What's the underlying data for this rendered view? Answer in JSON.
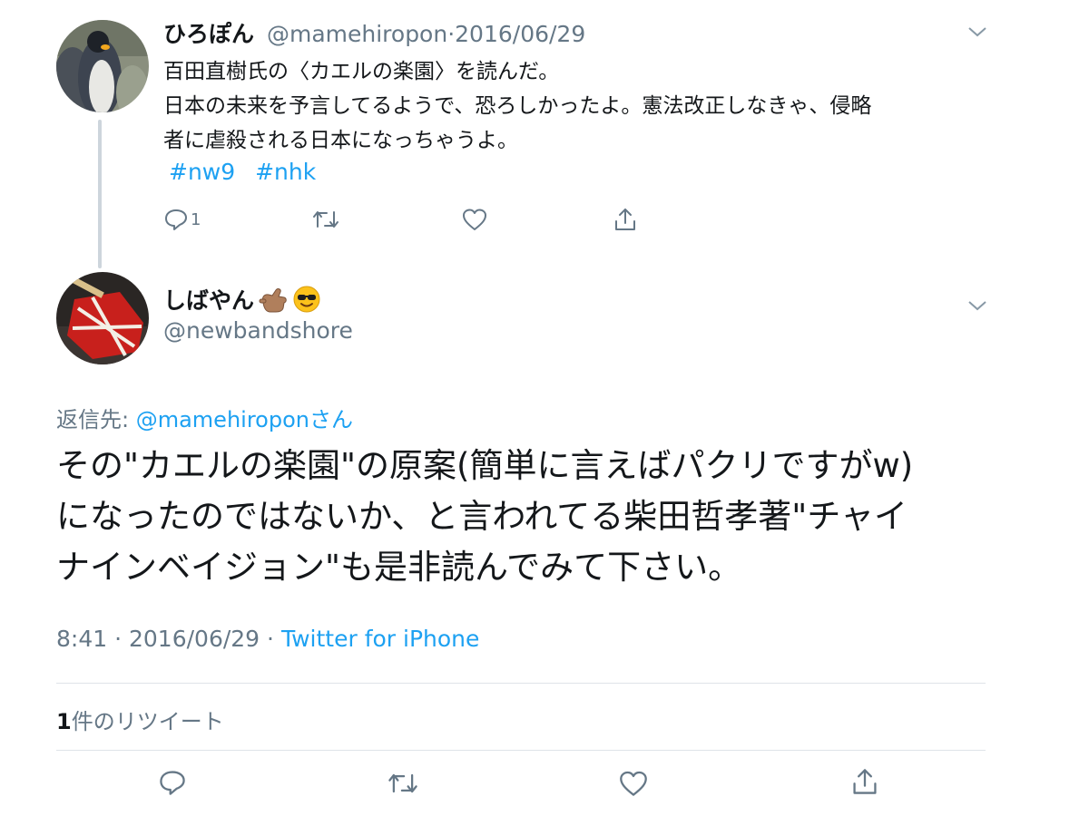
{
  "parent_tweet": {
    "display_name": "ひろぽん",
    "handle": "@mamehiropon",
    "separator": "·",
    "date": "2016/06/29",
    "lines": [
      "百田直樹氏の〈カエルの楽園〉を読んだ。",
      "日本の未来を予言してるようで、恐ろしかったよ。憲法改正しなきゃ、侵略",
      "者に虐殺される日本になっちゃうよ。"
    ],
    "hashtags": [
      "#nw9",
      "#nhk"
    ],
    "reply_count": "1",
    "icons": {
      "reply": "reply-icon",
      "retweet": "retweet-icon",
      "like": "heart-icon",
      "share": "share-icon",
      "more": "chevron-down-icon"
    }
  },
  "main_tweet": {
    "display_name": "しばやん",
    "handle": "@newbandshore",
    "name_emojis": [
      "call-me-hand-emoji",
      "sunglasses-emoji"
    ],
    "reply_label": "返信先: ",
    "reply_target": "@mamehiroponさん",
    "lines": [
      "その\"カエルの楽園\"の原案(簡単に言えばパクリですがw)",
      "になったのではないか、と言われてる柴田哲孝著\"チャイ",
      "ナインベイジョン\"も是非読んでみて下さい。"
    ],
    "time": "8:41",
    "date": "2016/06/29",
    "separator": "·",
    "source": "Twitter for iPhone",
    "retweet_number": "1",
    "retweet_label": "件のリツイート",
    "icons": {
      "reply": "reply-icon",
      "retweet": "retweet-icon",
      "like": "heart-icon",
      "share": "share-icon",
      "more": "chevron-down-icon"
    }
  },
  "colors": {
    "link": "#1da1f2",
    "secondary_text": "#657786",
    "primary_text": "#14171a",
    "thread_line": "#cdd5dc",
    "divider": "#dfe3e8"
  }
}
